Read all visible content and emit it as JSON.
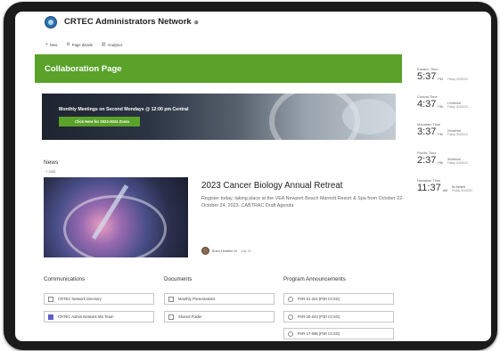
{
  "site": {
    "title": "CRTEC Administrators Network",
    "follow_glyph": "⊕"
  },
  "command_bar": {
    "new_label": "New",
    "page_details_label": "Page details",
    "analytics_label": "Analytics"
  },
  "hero": {
    "title": "Collaboration Page",
    "color": "#5aa22a"
  },
  "promo": {
    "text": "Monthly Meetings on Second Mondays @ 12:00 pm Central",
    "button_label": "Click Here for 2023-2024 Zoom"
  },
  "news": {
    "heading": "News",
    "add_label": "+ Add",
    "article": {
      "title": "2023 Cancer Biology Annual Retreat",
      "excerpt": "Register today, taking place at the VEA Newport Beach Marriott Resort & Spa from October 22-October 24, 2023. CABTRAC Draft Agenda",
      "author": "Brien,Heather M.",
      "date": "July 20"
    }
  },
  "columns": {
    "communications": {
      "heading": "Communications",
      "links": [
        "CRTEC Network Directory",
        "CRTEC Admin Network MS Team"
      ]
    },
    "documents": {
      "heading": "Documents",
      "links": [
        "Monthly Presentations",
        "Shared Folder"
      ]
    },
    "program_announcements": {
      "heading": "Program Announcements",
      "links": [
        "PAR-21-321 (P30 CCSG)",
        "PAR-20-043 (P30 CCSG)",
        "PAR-17-095 (P30 CCSG)"
      ]
    }
  },
  "world_clock": [
    {
      "zone": "Eastern Time",
      "time": "5:37",
      "ampm": "PM",
      "diff": "",
      "date": "Friday, 8/4/2023"
    },
    {
      "zone": "Central Time",
      "time": "4:37",
      "ampm": "PM",
      "diff": "1h behind",
      "date": "Friday, 8/4/2023"
    },
    {
      "zone": "Mountain Time",
      "time": "3:37",
      "ampm": "PM",
      "diff": "2h behind",
      "date": "Friday, 8/4/2023"
    },
    {
      "zone": "Pacific Time",
      "time": "2:37",
      "ampm": "PM",
      "diff": "3h behind",
      "date": "Friday, 8/4/2023"
    },
    {
      "zone": "Hawaiian Time",
      "time": "11:37",
      "ampm": "AM",
      "diff": "6h behind",
      "date": "Friday, 8/4/2023"
    }
  ]
}
